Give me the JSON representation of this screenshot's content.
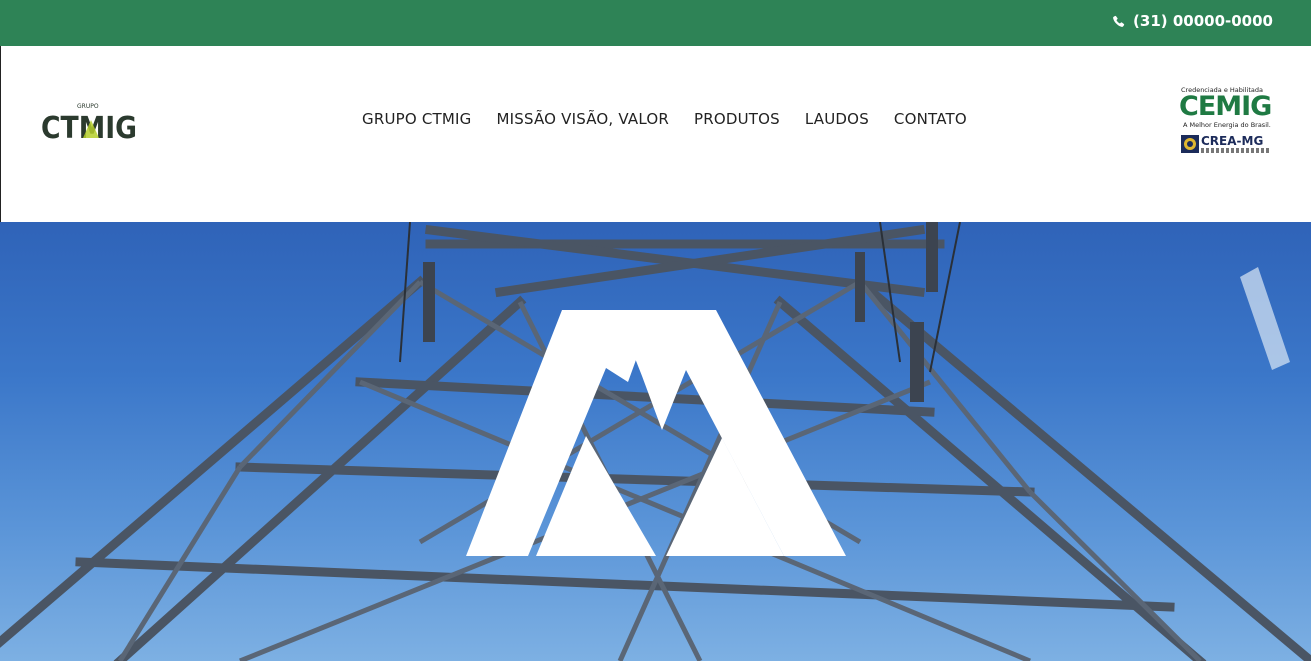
{
  "topbar": {
    "phone": "(31) 00000-0000",
    "phone_icon": "phone-icon",
    "background": "#2e8356"
  },
  "header": {
    "logo": {
      "small_text": "GRUPO",
      "main_text": "CTMIG"
    },
    "nav": [
      {
        "label": "GRUPO CTMIG"
      },
      {
        "label": "MISSÃO VISÃO, VALOR"
      },
      {
        "label": "PRODUTOS"
      },
      {
        "label": "LAUDOS"
      },
      {
        "label": "CONTATO"
      }
    ],
    "partner": {
      "credential_text": "Credenciada e Habilitada",
      "cemig_text": "CEMIG",
      "cemig_tagline": "A Melhor Energia do Brasil.",
      "crea_text": "CREA-MG"
    }
  },
  "hero": {
    "brand_mark": "ctmig-m-logo-mark",
    "background_subject": "transmission-tower-icon"
  },
  "colors": {
    "brand_green": "#2e8356",
    "logo_dark": "#2b3a2e",
    "logo_accent": "#b5cf2b",
    "sky_blue": "#3b77c9"
  }
}
